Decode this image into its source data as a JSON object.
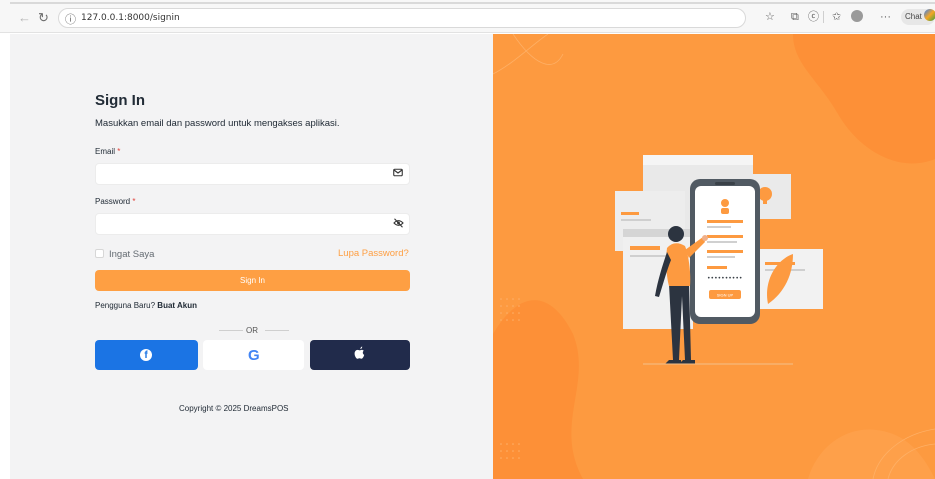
{
  "browser": {
    "url": "127.0.0.1:8000/signin",
    "chat_label": "Chat"
  },
  "signin": {
    "title": "Sign In",
    "subtitle": "Masukkan email dan password untuk mengakses aplikasi.",
    "email_label": "Email",
    "password_label": "Password",
    "required_mark": "*",
    "email_value": "",
    "password_value": "",
    "remember_label": "Ingat Saya",
    "forgot_label": "Lupa Password?",
    "submit_label": "Sign In",
    "new_user_text": "Pengguna Baru?",
    "create_account_label": "Buat Akun",
    "or_label": "OR",
    "copyright": "Copyright © 2025 DreamsPOS"
  },
  "illustration": {
    "button_text": "SIGN UP"
  },
  "colors": {
    "accent": "#fe9f43",
    "illustration_bg": "#fd9a40",
    "facebook": "#1b74e4",
    "apple": "#212b4b"
  }
}
